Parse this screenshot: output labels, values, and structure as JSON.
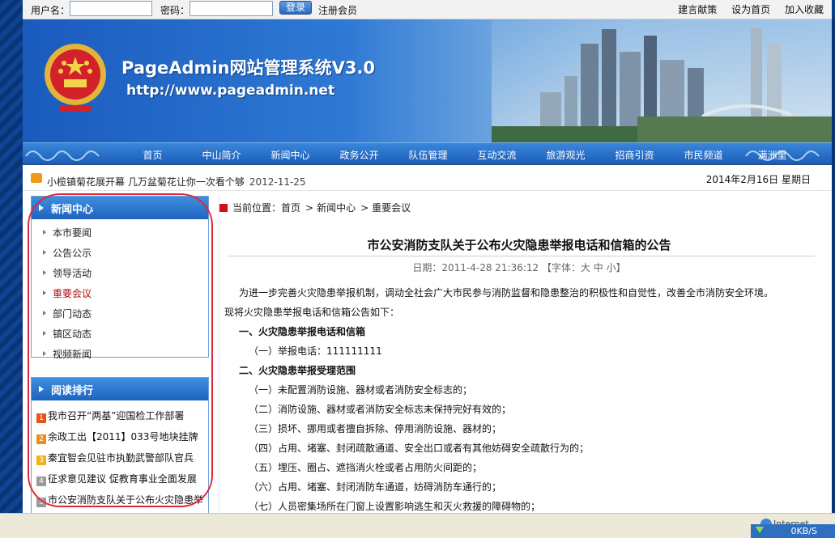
{
  "login": {
    "username_label": "用户名：",
    "password_label": "密码：",
    "login_button": "登录",
    "register_link": "注册会员"
  },
  "top_links": [
    "建言献策",
    "设为首页",
    "加入收藏"
  ],
  "banner": {
    "title": "PageAdmin网站管理系统V3.0",
    "url": "http://www.pageadmin.net"
  },
  "nav": [
    "首页",
    "中山简介",
    "新闻中心",
    "政务公开",
    "队伍管理",
    "互动交流",
    "旅游观光",
    "招商引资",
    "市民频道",
    "满洲里"
  ],
  "ticker": {
    "headline": "小榄镇菊花展开幕 几万盆菊花让你一次看个够",
    "date": "2012-11-25",
    "today": "2014年2月16日 星期日"
  },
  "sidebar": {
    "news_title": "新闻中心",
    "news_items": [
      "本市要闻",
      "公告公示",
      "领导活动",
      "重要会议",
      "部门动态",
      "镇区动态",
      "视频新闻"
    ],
    "active_item": "重要会议",
    "rank_title": "阅读排行",
    "rank_items": [
      {
        "num": "1",
        "color": "#e2551b",
        "text": "我市召开“两基”迎国检工作部署"
      },
      {
        "num": "2",
        "color": "#f08c1a",
        "text": "余政工出【2011】033号地块挂牌"
      },
      {
        "num": "3",
        "color": "#f0b41a",
        "text": "秦宜智会见驻市执勤武警部队官兵"
      },
      {
        "num": "4",
        "color": "#9a9a9a",
        "text": "征求意见建议 促教育事业全面发展"
      },
      {
        "num": "5",
        "color": "#9a9a9a",
        "text": "市公安消防支队关于公布火灾隐患举"
      }
    ]
  },
  "breadcrumb": {
    "prefix": "当前位置：",
    "items": [
      "首页",
      "新闻中心",
      "重要会议"
    ]
  },
  "article": {
    "title": "市公安消防支队关于公布火灾隐患举报电话和信箱的公告",
    "meta": "日期：2011-4-28 21:36:12 【字体：大 中 小】",
    "lines": [
      {
        "cls": "ind1",
        "text": "为进一步完善火灾隐患举报机制，调动全社会广大市民参与消防监督和隐患整治的积极性和自觉性，改善全市消防安全环境。"
      },
      {
        "cls": "",
        "text": "现将火灾隐患举报电话和信箱公告如下："
      },
      {
        "cls": "ind1 h",
        "text": "一、火灾隐患举报电话和信箱"
      },
      {
        "cls": "ind2",
        "text": "（一）举报电话：111111111"
      },
      {
        "cls": "ind1 h",
        "text": "二、火灾隐患举报受理范围"
      },
      {
        "cls": "ind2",
        "text": "（一）未配置消防设施、器材或者消防安全标志的；"
      },
      {
        "cls": "ind2",
        "text": "（二）消防设施、器材或者消防安全标志未保持完好有效的；"
      },
      {
        "cls": "ind2",
        "text": "（三）损坏、挪用或者擅自拆除、停用消防设施、器材的；"
      },
      {
        "cls": "ind2",
        "text": "（四）占用、堵塞、封闭疏散通道、安全出口或者有其他妨碍安全疏散行为的；"
      },
      {
        "cls": "ind2",
        "text": "（五）埋压、圈占、遮挡消火栓或者占用防火间距的；"
      },
      {
        "cls": "ind2",
        "text": "（六）占用、堵塞、封闭消防车通道，妨碍消防车通行的；"
      },
      {
        "cls": "ind2",
        "text": "（七）人员密集场所在门窗上设置影响逃生和灭火救援的障碍物的；"
      }
    ]
  },
  "status": {
    "zone": "Internet",
    "speed": "0KB/S"
  }
}
